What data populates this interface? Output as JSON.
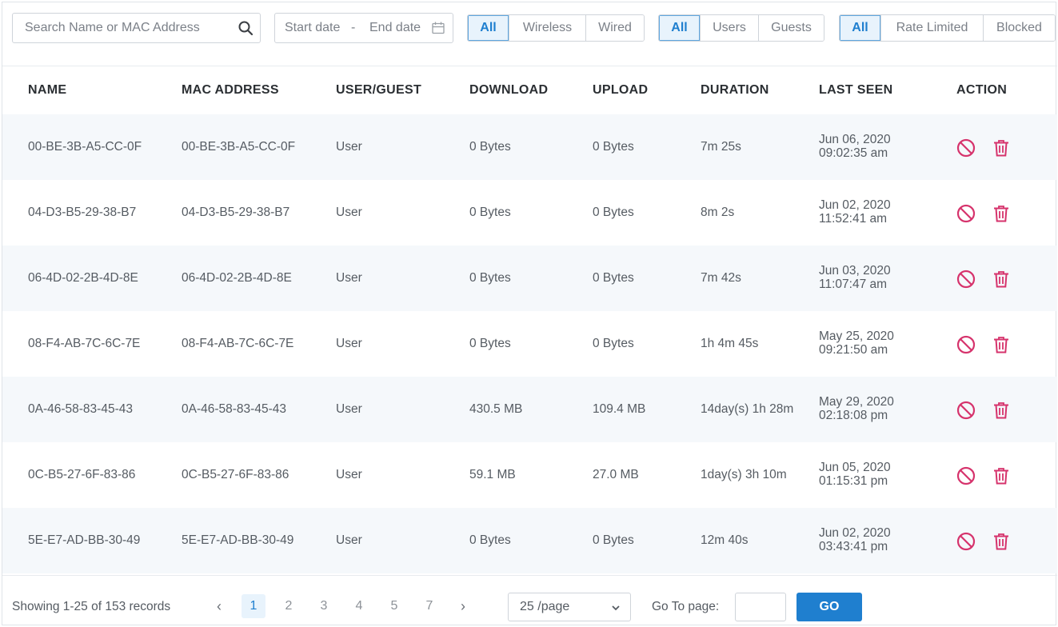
{
  "filters": {
    "search_placeholder": "Search Name or MAC Address",
    "start_date_placeholder": "Start date",
    "date_separator": "-",
    "end_date_placeholder": "End date",
    "connection": [
      "All",
      "Wireless",
      "Wired"
    ],
    "user_type": [
      "All",
      "Users",
      "Guests"
    ],
    "status": [
      "All",
      "Rate Limited",
      "Blocked"
    ]
  },
  "table": {
    "columns": [
      "NAME",
      "MAC ADDRESS",
      "USER/GUEST",
      "DOWNLOAD",
      "UPLOAD",
      "DURATION",
      "LAST SEEN",
      "ACTION"
    ],
    "rows": [
      {
        "name": "00-BE-3B-A5-CC-0F",
        "mac": "00-BE-3B-A5-CC-0F",
        "type": "User",
        "download": "0 Bytes",
        "upload": "0 Bytes",
        "duration": "7m 25s",
        "last_seen_date": "Jun 06, 2020",
        "last_seen_time": "09:02:35 am"
      },
      {
        "name": "04-D3-B5-29-38-B7",
        "mac": "04-D3-B5-29-38-B7",
        "type": "User",
        "download": "0 Bytes",
        "upload": "0 Bytes",
        "duration": "8m 2s",
        "last_seen_date": "Jun 02, 2020",
        "last_seen_time": "11:52:41 am"
      },
      {
        "name": "06-4D-02-2B-4D-8E",
        "mac": "06-4D-02-2B-4D-8E",
        "type": "User",
        "download": "0 Bytes",
        "upload": "0 Bytes",
        "duration": "7m 42s",
        "last_seen_date": "Jun 03, 2020",
        "last_seen_time": "11:07:47 am"
      },
      {
        "name": "08-F4-AB-7C-6C-7E",
        "mac": "08-F4-AB-7C-6C-7E",
        "type": "User",
        "download": "0 Bytes",
        "upload": "0 Bytes",
        "duration": "1h 4m 45s",
        "last_seen_date": "May 25, 2020",
        "last_seen_time": "09:21:50 am"
      },
      {
        "name": "0A-46-58-83-45-43",
        "mac": "0A-46-58-83-45-43",
        "type": "User",
        "download": "430.5 MB",
        "upload": "109.4 MB",
        "duration": "14day(s) 1h 28m",
        "last_seen_date": "May 29, 2020",
        "last_seen_time": "02:18:08 pm"
      },
      {
        "name": "0C-B5-27-6F-83-86",
        "mac": "0C-B5-27-6F-83-86",
        "type": "User",
        "download": "59.1 MB",
        "upload": "27.0 MB",
        "duration": "1day(s) 3h 10m",
        "last_seen_date": "Jun 05, 2020",
        "last_seen_time": "01:15:31 pm"
      },
      {
        "name": "5E-E7-AD-BB-30-49",
        "mac": "5E-E7-AD-BB-30-49",
        "type": "User",
        "download": "0 Bytes",
        "upload": "0 Bytes",
        "duration": "12m 40s",
        "last_seen_date": "Jun 02, 2020",
        "last_seen_time": "03:43:41 pm"
      }
    ]
  },
  "pagination": {
    "summary": "Showing 1-25 of 153 records",
    "prev_glyph": "‹",
    "next_glyph": "›",
    "pages": [
      "1",
      "2",
      "3",
      "4",
      "5",
      "7"
    ],
    "current_page": "1",
    "page_size": "25 /page",
    "goto_label": "Go To page:",
    "go_label": "GO"
  },
  "icons": {
    "search": "search-icon",
    "calendar": "calendar-icon",
    "block": "block-icon",
    "delete": "trash-icon",
    "dropdown": "chevron-down-icon"
  },
  "colors": {
    "accent": "#1f7fcf",
    "active_bg": "#e8f3fc",
    "action_red": "#d6336c",
    "row_alt": "#f5f8fb"
  }
}
